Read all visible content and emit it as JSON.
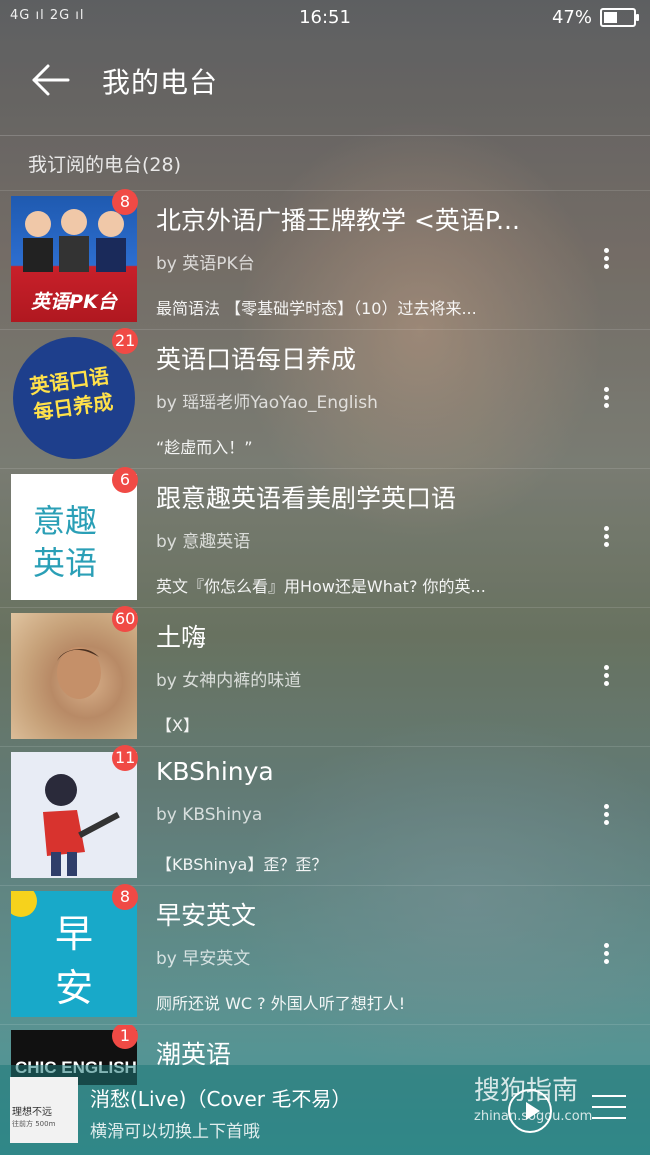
{
  "status_bar": {
    "left": "4G ıl 2G ıl",
    "time": "16:51",
    "battery": "47%",
    "battery_level": 0.47
  },
  "header": {
    "title": "我的电台"
  },
  "section": {
    "title": "我订阅的电台(28)"
  },
  "stations": [
    {
      "badge": "8",
      "name": "北京外语广播王牌教学 <英语P...",
      "by": "by 英语PK台",
      "latest": "最简语法 【零基础学时态】（10）过去将来..."
    },
    {
      "badge": "21",
      "name": "英语口语每日养成",
      "by": "by 瑶瑶老师YaoYao_English",
      "latest": "“趁虚而入！”"
    },
    {
      "badge": "6",
      "name": "跟意趣英语看美剧学英口语",
      "by": "by 意趣英语",
      "latest": "英文『你怎么看』用How还是What? 你的英..."
    },
    {
      "badge": "60",
      "name": "土嗨",
      "by": "by 女神内裤的味道",
      "latest": "【X】"
    },
    {
      "badge": "11",
      "name": "KBShinya",
      "by": "by KBShinya",
      "latest": "【KBShinya】歪？歪？"
    },
    {
      "badge": "8",
      "name": "早安英文",
      "by": "by 早安英文",
      "latest": "厕所还说 WC ? 外国人听了想打人!"
    },
    {
      "badge": "1",
      "name": "潮英语",
      "by": "",
      "latest": ""
    }
  ],
  "thumbs": {
    "t1": "英语PK台",
    "t2_line1": "英语口语",
    "t2_line2": "每日养成",
    "t3_line1": "意趣",
    "t3_line2": "英语",
    "t6_line1": "早",
    "t6_line2": "安",
    "t7": "CHIC ENGLISH"
  },
  "player": {
    "title": "消愁(Live)（Cover 毛不易）",
    "subtitle": "横滑可以切换上下首哦",
    "cover_text": "理想不远",
    "cover_sub": "往前方 500m"
  },
  "watermark": {
    "brand": "搜狗指南",
    "url": "zhinan.sogou.com"
  }
}
